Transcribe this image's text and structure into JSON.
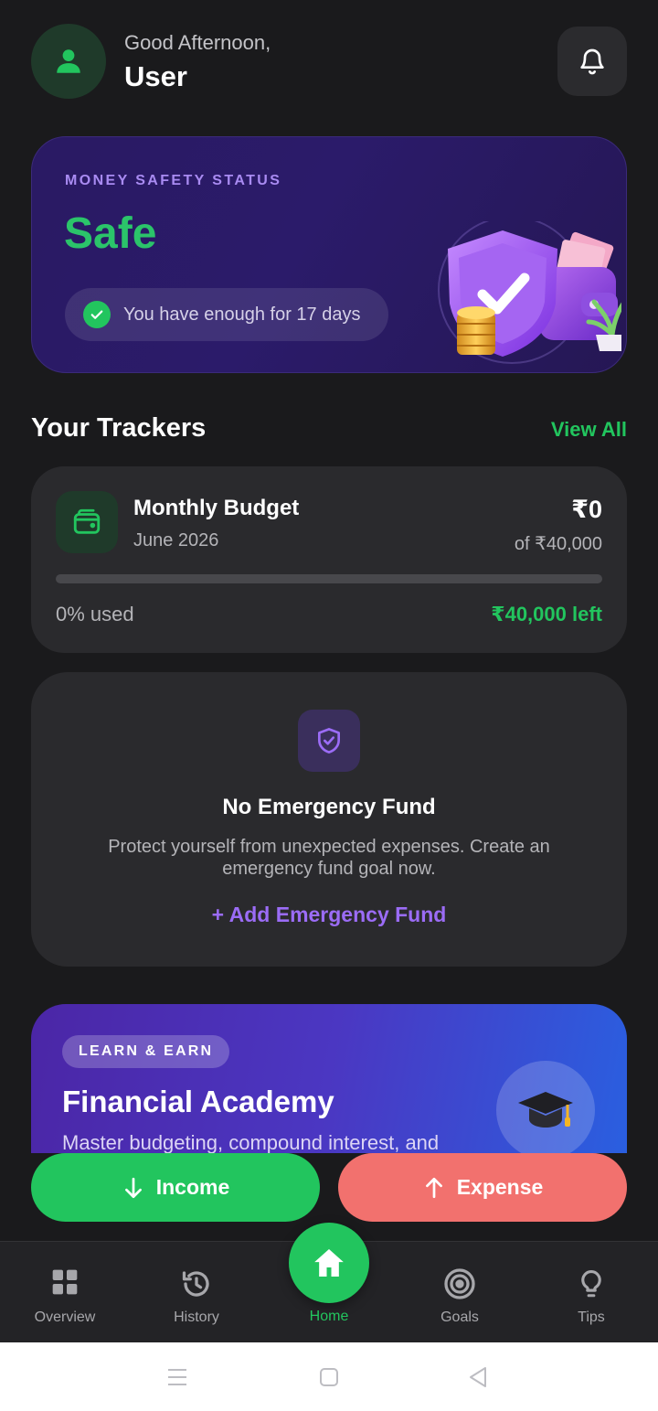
{
  "header": {
    "greeting": "Good Afternoon,",
    "username": "User"
  },
  "safety": {
    "label": "MONEY SAFETY STATUS",
    "status": "Safe",
    "message": "You have enough for 17 days",
    "status_color": "#22c55e"
  },
  "trackers": {
    "title": "Your Trackers",
    "view_all": "View All"
  },
  "budget": {
    "name": "Monthly Budget",
    "month": "June 2026",
    "spent": "₹0",
    "total": "of ₹40,000",
    "used_text": "0% used",
    "used_fraction": 0,
    "left_text": "₹40,000 left"
  },
  "emergency": {
    "title": "No Emergency Fund",
    "description": "Protect yourself from unexpected expenses. Create an emergency fund goal now.",
    "add_label": "+ Add Emergency Fund"
  },
  "academy": {
    "badge": "LEARN & EARN",
    "title": "Financial Academy",
    "description": "Master budgeting, compound interest, and"
  },
  "actions": {
    "income": "Income",
    "expense": "Expense"
  },
  "nav": {
    "items": [
      {
        "label": "Overview",
        "icon": "grid-icon"
      },
      {
        "label": "History",
        "icon": "history-icon"
      },
      {
        "label": "Home",
        "icon": "home-icon",
        "active": true
      },
      {
        "label": "Goals",
        "icon": "target-icon"
      },
      {
        "label": "Tips",
        "icon": "lightbulb-icon"
      }
    ]
  },
  "colors": {
    "accent": "#22c55e",
    "expense": "#f2716e",
    "purple": "#9b6cf6",
    "background": "#1a1a1c"
  }
}
